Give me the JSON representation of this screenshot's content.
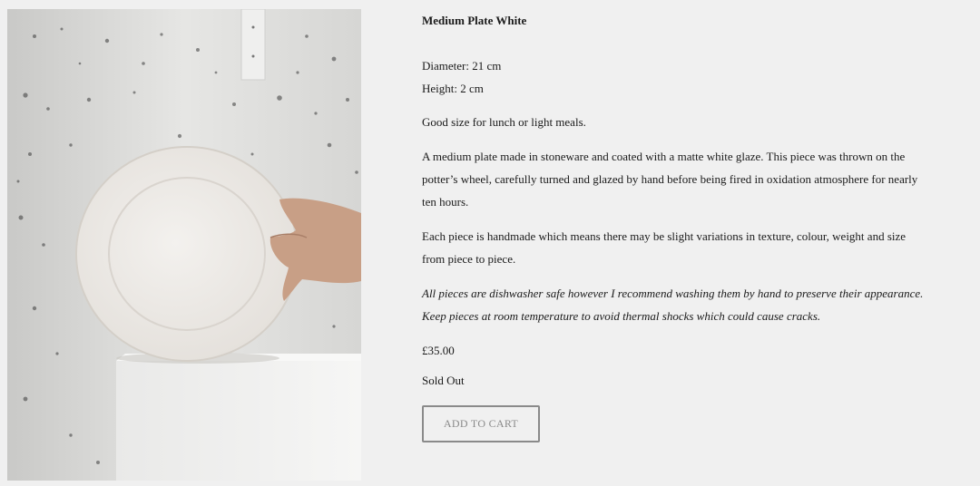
{
  "product": {
    "title": "Medium Plate White",
    "image_alt": "Hand holding a white stoneware plate on a white plinth against a speckled wall",
    "specs": {
      "diameter": "Diameter: 21 cm",
      "height": "Height: 2 cm"
    },
    "summary": "Good size for lunch or light meals.",
    "description": "A medium plate made in stoneware and coated with a matte white glaze. This piece was thrown on the potter’s wheel, carefully turned and glazed by hand before being fired in oxidation atmosphere for nearly ten hours.",
    "handmade_note": "Each piece is handmade which means there may be slight variations in texture, colour, weight and size from piece to piece.",
    "care_note": "All pieces are dishwasher safe however I recommend washing them by hand to preserve their appearance. Keep pieces at room temperature to avoid thermal shocks which could cause cracks.",
    "price": "£35.00",
    "stock_status": "Sold Out",
    "cart_button_label": "ADD TO CART"
  },
  "colors": {
    "background": "#f0f0f0",
    "text": "#1a1a1a",
    "button_border": "#8a8a8a"
  }
}
